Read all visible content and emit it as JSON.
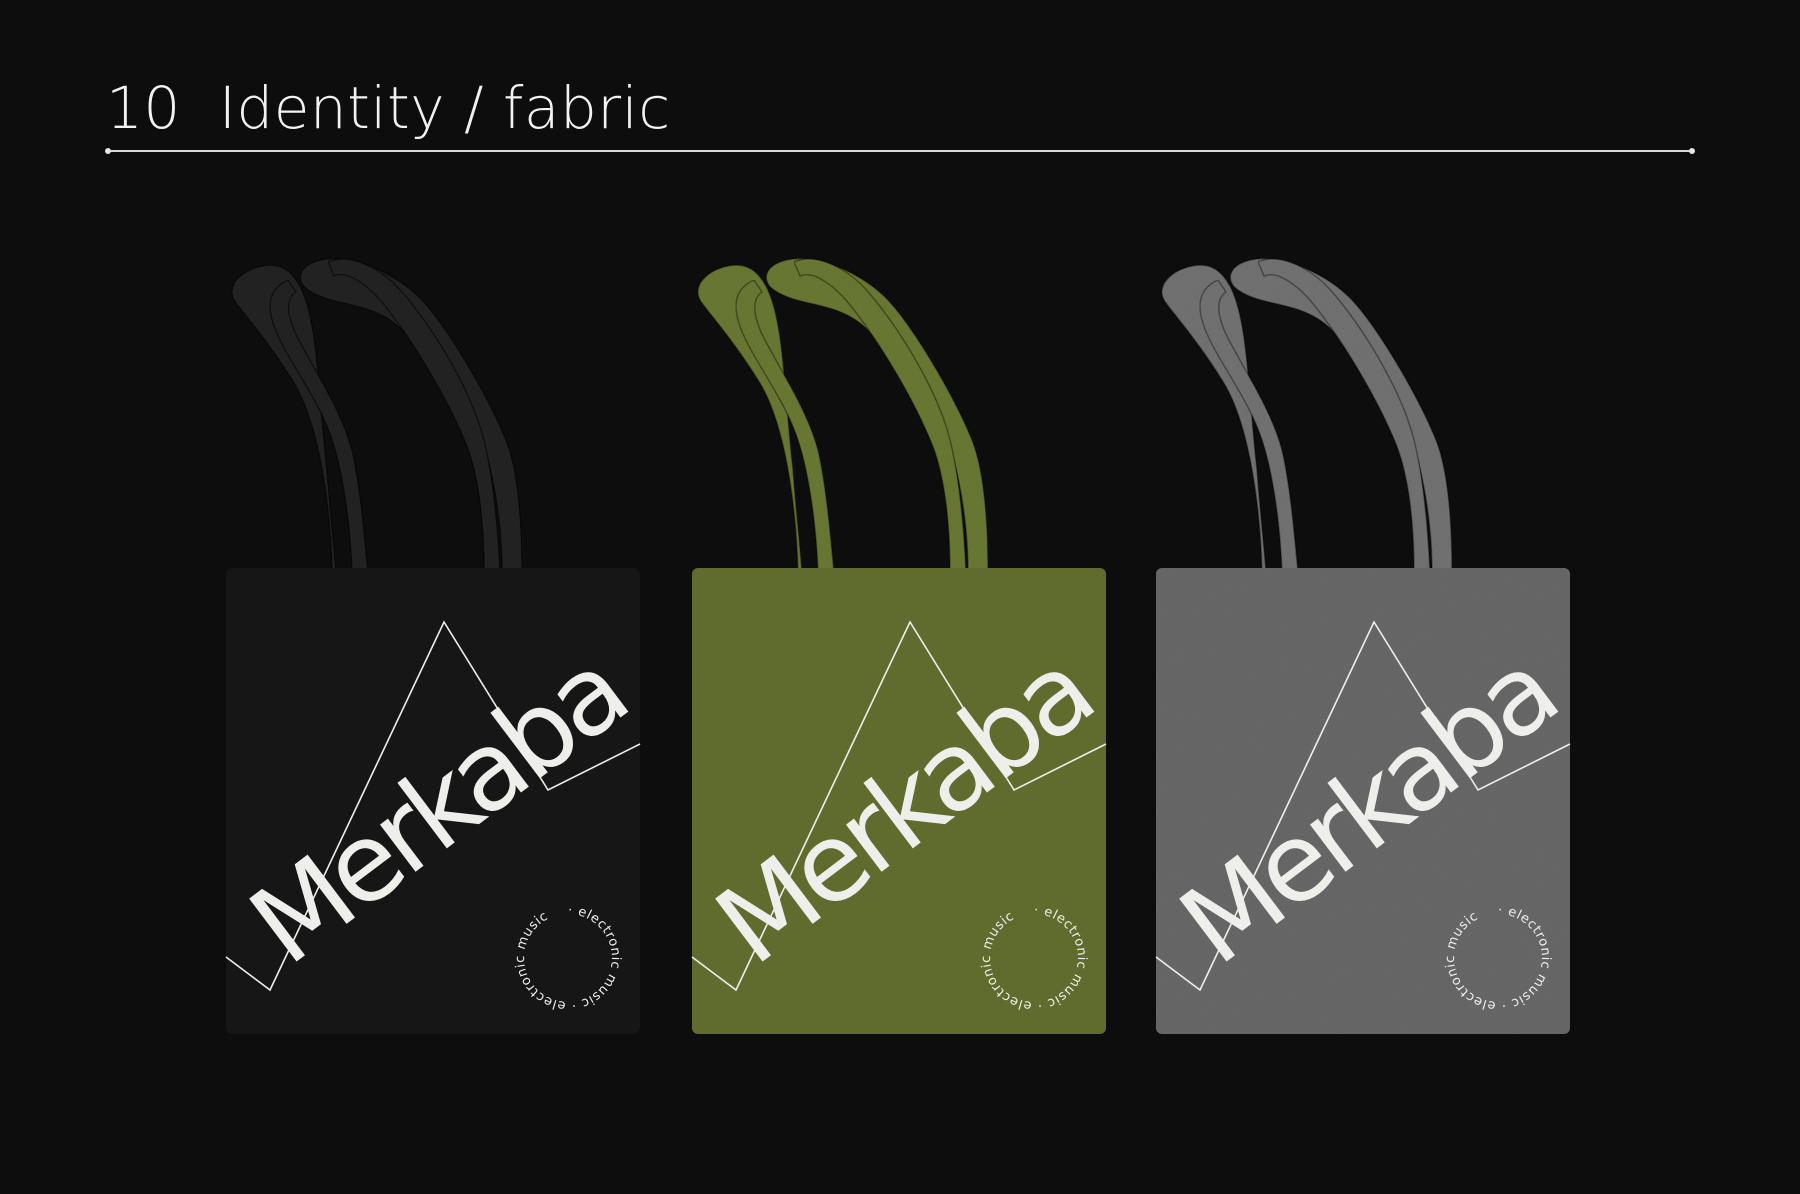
{
  "header": {
    "number": "10",
    "title": "Identity / fabric"
  },
  "brand": {
    "wordmark": "Merkaba",
    "ring_text": "· electronic music · electronic music"
  },
  "bags": [
    {
      "name": "black",
      "color": "#1d1d1e",
      "handle_color": "#262627"
    },
    {
      "name": "olive",
      "color": "#637032",
      "handle_color": "#6b7a35"
    },
    {
      "name": "grey",
      "color": "#696969",
      "handle_color": "#737373"
    }
  ],
  "colors": {
    "background": "#0d0d0e",
    "print": "#eeeeea",
    "rule": "#d9d9d9"
  }
}
